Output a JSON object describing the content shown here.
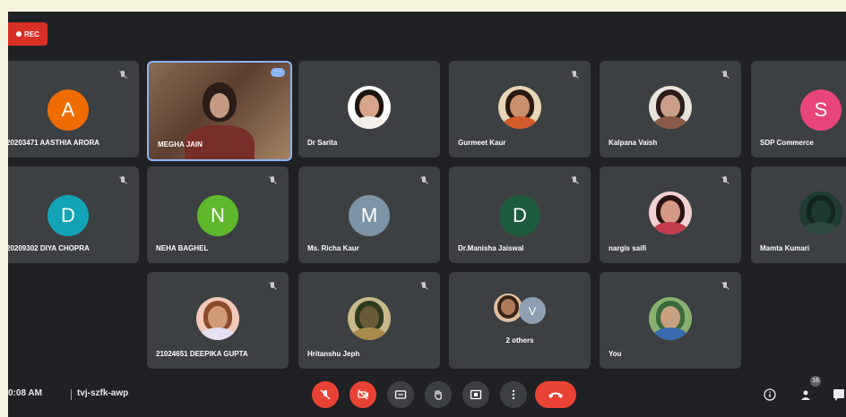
{
  "recording": {
    "label": "REC"
  },
  "participants": [
    {
      "name": "20203471 AASTHIA ARORA",
      "initial": "A",
      "color": "#ef6c00",
      "type": "initial"
    },
    {
      "name": "MEGHA JAIN",
      "type": "video"
    },
    {
      "name": "Dr Sarita",
      "type": "photo",
      "skin": "#d8a58a",
      "hair": "#1e1512",
      "top": "#f3efe8",
      "bg": "#ffffff"
    },
    {
      "name": "Gurmeet Kaur",
      "type": "photo",
      "skin": "#c9906e",
      "hair": "#2a1a12",
      "top": "#d35a2a",
      "bg": "#e9d6b8"
    },
    {
      "name": "Kalpana Vaish",
      "type": "photo",
      "skin": "#caa08a",
      "hair": "#2b1d18",
      "top": "#8a5a48",
      "bg": "#e8e4dc"
    },
    {
      "name": "SDP Commerce",
      "initial": "S",
      "color": "#e8457a",
      "type": "initial"
    },
    {
      "name": "20209302 DIYA CHOPRA",
      "initial": "D",
      "color": "#12a4b6",
      "type": "initial"
    },
    {
      "name": "NEHA BAGHEL",
      "initial": "N",
      "color": "#5fb82c",
      "type": "initial"
    },
    {
      "name": "Ms. Richa Kaur",
      "initial": "M",
      "color": "#7d93a6",
      "type": "initial"
    },
    {
      "name": "Dr.Manisha Jaiswal",
      "initial": "D",
      "color": "#1e5a3c",
      "type": "initial"
    },
    {
      "name": "nargis saifi",
      "type": "photo",
      "skin": "#d49a86",
      "hair": "#2a1412",
      "top": "#c23a4c",
      "bg": "#f0d0d0"
    },
    {
      "name": "Mamta Kumari",
      "type": "photo",
      "skin": "#1d3a32",
      "hair": "#12261f",
      "top": "#2c4a40",
      "bg": "#1f3b33"
    },
    {
      "name": "21024651 DEEPIKA GUPTA",
      "type": "photo",
      "skin": "#d09a7a",
      "hair": "#8a4a2a",
      "top": "#e6e0f2",
      "bg": "#f2c8b8"
    },
    {
      "name": "Hritanshu Jeph",
      "type": "photo",
      "skin": "#6a5a38",
      "hair": "#2d3a1e",
      "top": "#a88b4a",
      "bg": "#c9b98a"
    },
    {
      "name": "2 others",
      "type": "others",
      "initial": "V"
    },
    {
      "name": "You",
      "type": "photo",
      "skin": "#c7a080",
      "hair": "#3a6a3a",
      "top": "#3a6ab0",
      "bg": "#8ab070"
    }
  ],
  "meeting": {
    "time": "0:08 AM",
    "code": "tvj-szfk-awp"
  },
  "people_count": "16"
}
